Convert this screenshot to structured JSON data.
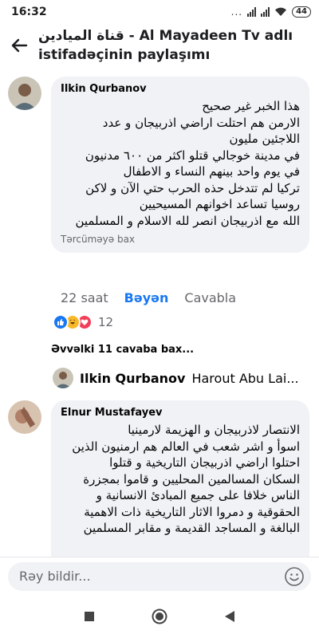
{
  "status_bar": {
    "time": "16:32",
    "dots": "...",
    "battery": "44"
  },
  "header": {
    "title": "قناة الميادين - Al Mayadeen Tv adlı istifadəçinin paylaşımı"
  },
  "comment1": {
    "author": "Ilkin Qurbanov",
    "lines": [
      "هذا الخبر غير صحيح",
      "الارمن هم احتلت اراضي اذربيجان و عدد",
      "اللاجئين مليون",
      "في مدينة خوجالي قتلو اكثر من ٦٠٠ مدنيون",
      "في يوم واحد بينهم النساء و الاطفال",
      "تركيا لم تتدخل حذه الحرب حتي الآن و لاكن",
      "روسيا تساعد اخوانهم المسيحيين",
      "الله مع اذربيجان انصر لله الاسلام و المسلمين"
    ],
    "translate": "Tərcüməyə bax"
  },
  "actions": {
    "time": "22 saat",
    "like": "Bəyən",
    "reply": "Cavabla"
  },
  "reactions": {
    "icons": [
      "like-icon",
      "haha-icon",
      "love-icon"
    ],
    "count": "12"
  },
  "previous_replies": "Əvvəlki 11 cavaba bax...",
  "reply_preview": {
    "author": "Ilkin Qurbanov",
    "text": "Harout Abu Lai..."
  },
  "comment2": {
    "author": "Elnur Mustafayev",
    "lines": [
      "الانتصار لاذربيجان و الهزيمة لارمينيا",
      "اسوأ و اشر شعب في العالم هم ارمنيون الذين",
      "احتلوا اراضي اذربيجان التاريخية و قتلوا",
      "السكان المسالمين المحليين و قاموا بمجزرة",
      "الناس خلافا على جميع المبادئ الانسانية و",
      "الحقوقية و دمروا الاثار التاريخية ذات الاهمية",
      "البالغة و المساجد القديمة و مقابر المسلمين"
    ]
  },
  "composer": {
    "placeholder": "Rəy bildir..."
  },
  "colors": {
    "accent": "#1877f2",
    "bubble": "#f0f2f5",
    "secondary_text": "#65676b"
  }
}
